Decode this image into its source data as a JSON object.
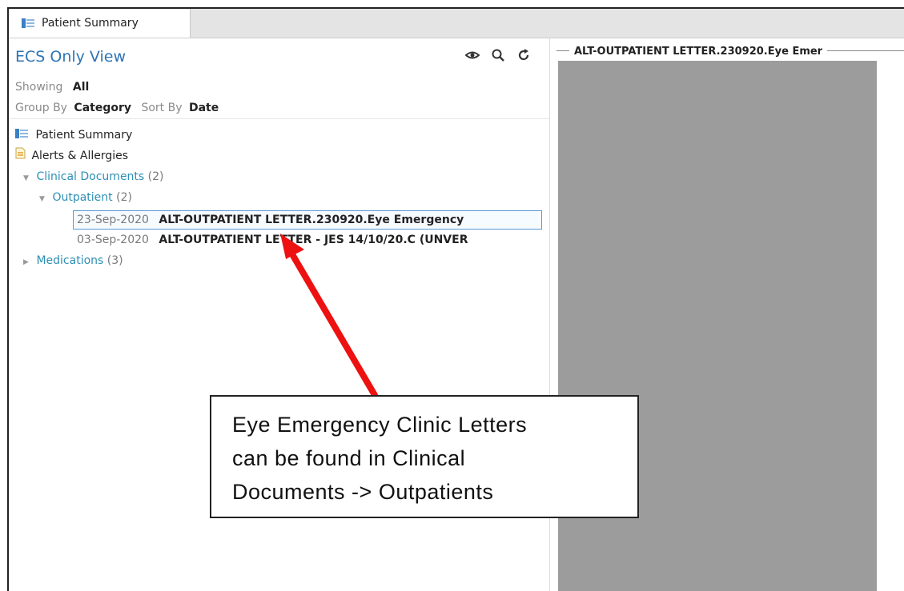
{
  "tab": {
    "label": "Patient Summary",
    "icon": "summary-icon"
  },
  "left": {
    "view_title": "ECS Only View",
    "showing_label": "Showing",
    "showing_value": "All",
    "group_label": "Group By",
    "group_value": "Category",
    "sort_label": "Sort By",
    "sort_value": "Date",
    "tool_icons": [
      "eye-icon",
      "search-icon",
      "refresh-icon"
    ]
  },
  "tree": {
    "patient_summary": "Patient Summary",
    "alerts": "Alerts & Allergies",
    "clinical_docs": "Clinical Documents",
    "clinical_docs_count": "(2)",
    "outpatient": "Outpatient",
    "outpatient_count": "(2)",
    "docs": [
      {
        "date": "23-Sep-2020",
        "title": "ALT-OUTPATIENT LETTER.230920.Eye Emergency",
        "selected": true
      },
      {
        "date": "03-Sep-2020",
        "title": "ALT-OUTPATIENT LETTER - JES 14/10/20.C (UNVER",
        "selected": false
      }
    ],
    "medications": "Medications",
    "medications_count": "(3)"
  },
  "right": {
    "doc_title": "ALT-OUTPATIENT LETTER.230920.Eye Emer"
  },
  "callout": {
    "line1": "Eye Emergency Clinic Letters",
    "line2": "can be found in Clinical",
    "line3": "Documents -> Outpatients"
  },
  "colors": {
    "link_blue": "#2e74b5",
    "tree_blue": "#2e8fb5",
    "arrow_red": "#ee1111",
    "viewer_gray": "#9c9c9c"
  }
}
